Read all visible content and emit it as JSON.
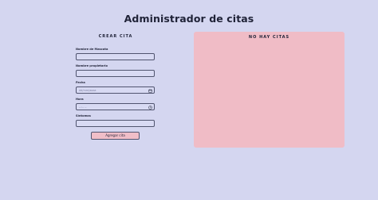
{
  "page": {
    "title": "Administrador de citas"
  },
  "form": {
    "heading": "CREAR CITA",
    "fields": [
      {
        "label": "Nombre de Mascota",
        "value": "",
        "placeholder": ""
      },
      {
        "label": "Nombre propietario",
        "value": "",
        "placeholder": ""
      },
      {
        "label": "Fecha",
        "value": "",
        "placeholder": "dd/mm/aaaa",
        "icon": "calendar-icon"
      },
      {
        "label": "Hora",
        "value": "",
        "placeholder": "--:-- --",
        "icon": "clock-icon"
      },
      {
        "label": "Síntomas",
        "value": "",
        "placeholder": ""
      }
    ],
    "submit_label": "Agregar cita"
  },
  "appointments": {
    "empty_message": "NO HAY CITAS"
  },
  "colors": {
    "background": "#d4d6f0",
    "accent": "#f0bcc6"
  }
}
